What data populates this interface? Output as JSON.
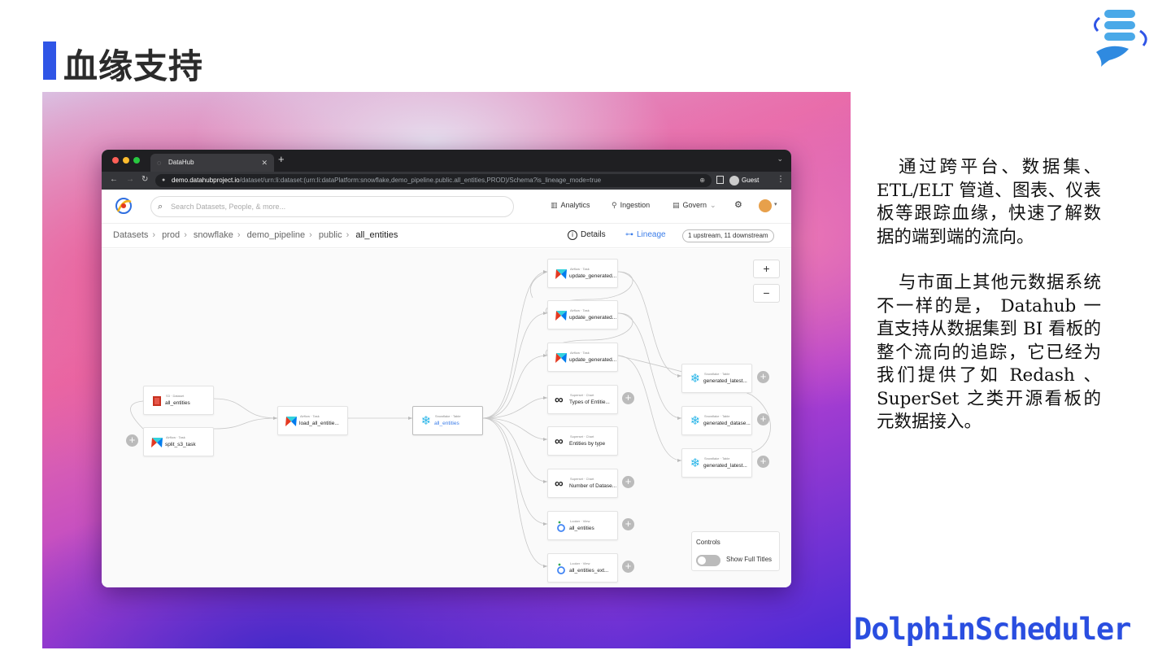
{
  "slide": {
    "title": "血缘支持",
    "paragraph1": "通过跨平台、数据集、ETL/ELT 管道、图表、仪表板等跟踪血缘，快速了解数据的端到端的流向。",
    "paragraph2": "与市面上其他元数据系统不一样的是， Datahub 一直支持从数据集到 BI 看板的整个流向的追踪，它已经为我们提供了如 Redash 、 SuperSet 之类开源看板的元数据接入。",
    "brand": "DolphinScheduler"
  },
  "browser": {
    "tab_title": "DataHub",
    "url_host": "demo.datahubproject.io",
    "url_path": "/dataset/urn:li:dataset:(urn:li:dataPlatform:snowflake,demo_pipeline.public.all_entities,PROD)/Schema?is_lineage_mode=true",
    "profile": "Guest"
  },
  "app": {
    "search_placeholder": "Search Datasets, People, & more...",
    "nav": {
      "analytics": "Analytics",
      "ingestion": "Ingestion",
      "govern": "Govern"
    },
    "breadcrumb": [
      "Datasets",
      "prod",
      "snowflake",
      "demo_pipeline",
      "public"
    ],
    "breadcrumb_current": "all_entities",
    "details": "Details",
    "lineage": "Lineage",
    "lineage_count": "1 upstream, 11 downstream",
    "controls_label": "Controls",
    "show_full_titles": "Show Full Titles",
    "nodes": [
      {
        "sub": "S3 · Dataset",
        "name": "all_entities"
      },
      {
        "sub": "Airflow · Task",
        "name": "split_s3_task"
      },
      {
        "sub": "Airflow · Task",
        "name": "load_all_entitie..."
      },
      {
        "sub": "Snowflake · Table",
        "name": "all_entities"
      },
      {
        "sub": "Airflow · Task",
        "name": "update_generated..."
      },
      {
        "sub": "Airflow · Task",
        "name": "update_generated..."
      },
      {
        "sub": "Airflow · Task",
        "name": "update_generated..."
      },
      {
        "sub": "Superset · Chart",
        "name": "Types of Entitie..."
      },
      {
        "sub": "Superset · Chart",
        "name": "Entities by type"
      },
      {
        "sub": "Superset · Chart",
        "name": "Number of Datase..."
      },
      {
        "sub": "Looker · View",
        "name": "all_entities"
      },
      {
        "sub": "Looker · View",
        "name": "all_entities_ext..."
      },
      {
        "sub": "Snowflake · Table",
        "name": "generated_latest..."
      },
      {
        "sub": "Snowflake · Table",
        "name": "generated_datase..."
      },
      {
        "sub": "Snowflake · Table",
        "name": "generated_latest..."
      }
    ]
  },
  "colors": {
    "accent": "#2f55e6",
    "lineage_blue": "#3b7de9",
    "airflow_red": "#e43921",
    "snowflake_blue": "#29b5e8"
  }
}
